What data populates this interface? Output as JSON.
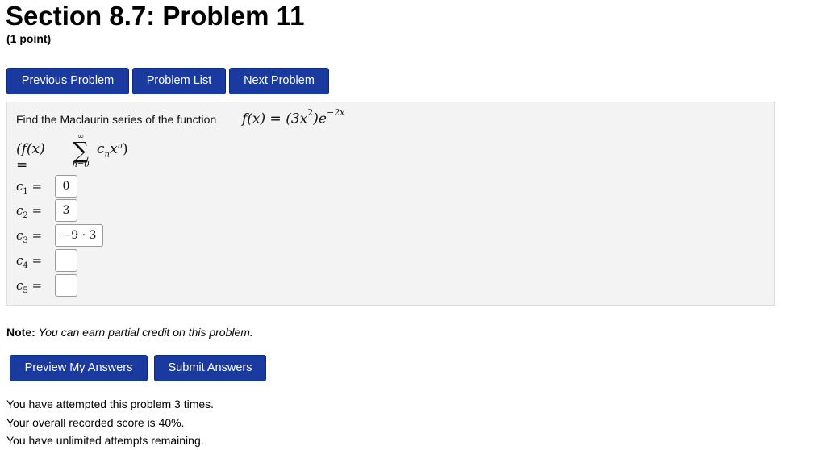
{
  "header": {
    "title": "Section 8.7: Problem 11",
    "points": "(1 point)"
  },
  "nav": {
    "previous": "Previous Problem",
    "list": "Problem List",
    "next": "Next Problem"
  },
  "problem": {
    "prompt": "Find the Maclaurin series of the function",
    "function": {
      "lhs": "f(x) = (3x",
      "sq": "2",
      "rhs": ")e",
      "exp": "−2x"
    },
    "series": {
      "lparen": "(f(x) =",
      "upper": "∞",
      "sigma": "∑",
      "lower": "n=0",
      "term": "c",
      "term_sub": "n",
      "term_x": "x",
      "term_sup": "n",
      "rparen": ")"
    },
    "coefficients": [
      {
        "label": "c",
        "sub": "1",
        "eq": " =",
        "value": "0"
      },
      {
        "label": "c",
        "sub": "2",
        "eq": " =",
        "value": "3"
      },
      {
        "label": "c",
        "sub": "3",
        "eq": " =",
        "value": "−9 · 3"
      },
      {
        "label": "c",
        "sub": "4",
        "eq": " =",
        "value": ""
      },
      {
        "label": "c",
        "sub": "5",
        "eq": " =",
        "value": ""
      }
    ]
  },
  "note": {
    "label": "Note:",
    "text": "You can earn partial credit on this problem."
  },
  "actions": {
    "preview": "Preview My Answers",
    "submit": "Submit Answers"
  },
  "status": {
    "attempts": "You have attempted this problem 3 times.",
    "score": "Your overall recorded score is 40%.",
    "remaining": "You have unlimited attempts remaining."
  },
  "colors": {
    "button_bg": "#1a3aa0",
    "panel_bg": "#f3f3f3"
  }
}
